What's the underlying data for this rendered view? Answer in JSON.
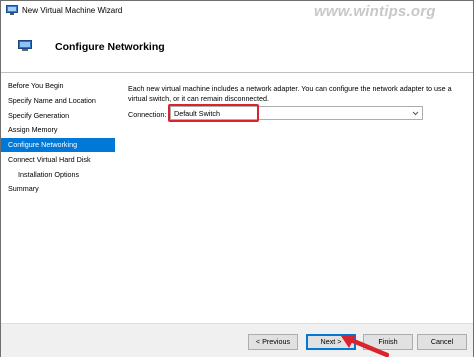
{
  "window": {
    "title": "New Virtual Machine Wizard",
    "watermark": "www.wintips.org"
  },
  "header": {
    "title": "Configure Networking",
    "icon": "network-adapter-icon"
  },
  "sidebar": {
    "items": [
      {
        "label": "Before You Begin",
        "selected": false,
        "indent": false
      },
      {
        "label": "Specify Name and Location",
        "selected": false,
        "indent": false
      },
      {
        "label": "Specify Generation",
        "selected": false,
        "indent": false
      },
      {
        "label": "Assign Memory",
        "selected": false,
        "indent": false
      },
      {
        "label": "Configure Networking",
        "selected": true,
        "indent": false
      },
      {
        "label": "Connect Virtual Hard Disk",
        "selected": false,
        "indent": false
      },
      {
        "label": "Installation Options",
        "selected": false,
        "indent": true
      },
      {
        "label": "Summary",
        "selected": false,
        "indent": false
      }
    ]
  },
  "main": {
    "description": "Each new virtual machine includes a network adapter. You can configure the network adapter to use a virtual switch, or it can remain disconnected.",
    "connection_label": "Connection:",
    "connection_value": "Default Switch"
  },
  "footer": {
    "previous_label": "< Previous",
    "next_label": "Next >",
    "finish_label": "Finish",
    "cancel_label": "Cancel"
  },
  "colors": {
    "selection": "#0078d7",
    "annotation": "#d9232e"
  }
}
